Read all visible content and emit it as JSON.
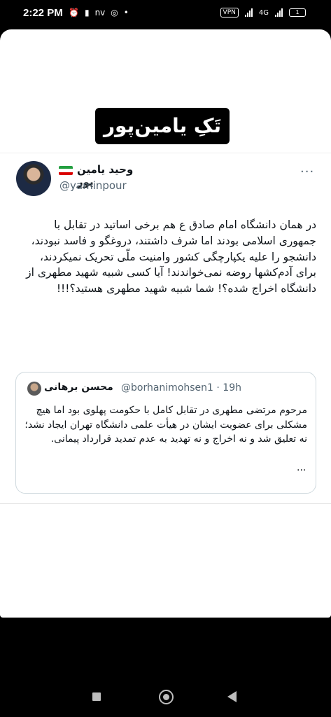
{
  "status_bar": {
    "time": "2:22 PM",
    "left_icons": [
      "alarm-icon",
      "battery-saver-icon",
      "nv",
      "instagram-icon",
      "dot"
    ],
    "vpn": "VPN",
    "network": "4G",
    "battery": "1"
  },
  "banner": {
    "title": "تَکِ یامین‌پور"
  },
  "tweet": {
    "author_name": "وحید یامین پور",
    "handle": "@yaminpour",
    "more": "···",
    "text": "در همان دانشگاه امام صادق ع هم برخی اساتید در تقابل با جمهوری اسلامی بودند اما شرف داشتند، دروغگو و فاسد نبودند، دانشجو را علیه یکپارچگی کشور وامنیت ملّی تحریک نمیکردند، برای آدم‌کشها روضه نمی‌خواندند! آیا کسی شبیه شهید مطهری از دانشگاه اخراج شده؟! شما شبیه شهید مطهری هستید؟!!!"
  },
  "quote": {
    "author_name": "محسن برهانی",
    "handle": "@borhanimohsen1 · 19h",
    "text": "مرحوم مرتضی مطهری در تقابل کامل با حکومت پهلوی بود اما هیچ مشکلی برای عضویت ایشان در هیأت علمی دانشگاه تهران ایجاد نشد؛ نه تعلیق شد و نه اخراج و نه تهدید به عدم تمدید قرارداد پیمانی.",
    "ellipsis": "..."
  },
  "colors": {
    "text": "#0f1419",
    "secondary": "#536471",
    "border": "#cfd9de",
    "flag_green": "#239f40",
    "flag_white": "#ffffff",
    "flag_red": "#da0000"
  }
}
